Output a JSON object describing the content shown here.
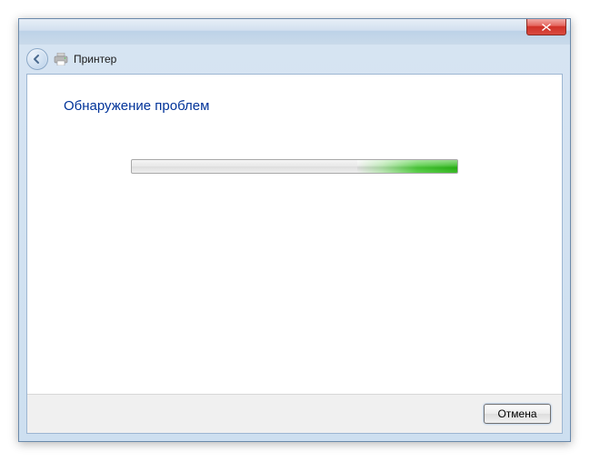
{
  "window": {
    "title": "Принтер"
  },
  "content": {
    "heading": "Обнаружение проблем"
  },
  "footer": {
    "cancel_label": "Отмена"
  }
}
